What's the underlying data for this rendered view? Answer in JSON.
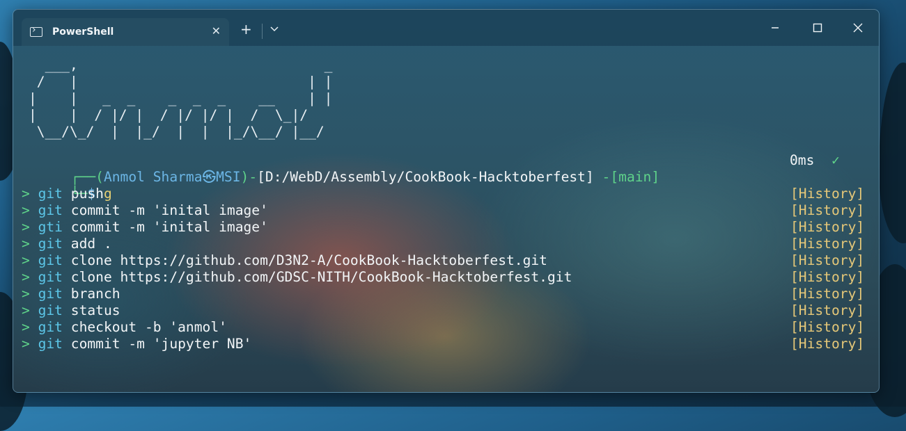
{
  "tab": {
    "title": "PowerShell",
    "close_glyph": "✕"
  },
  "controls": {
    "new_tab": "+",
    "dropdown": "chevron-down-icon",
    "minimize": "minimize-icon",
    "maximize": "maximize-icon",
    "close": "close-icon"
  },
  "ascii_art": "  ___,                              _\n /   |                            | |\n|    |   _  _    _  _  _    __    | |\n|    |  / |/ |  / |/ |/ |  /  \\_|/\n \\__/\\_/  |  |_/  |  |  |_/\\__/ |__/",
  "prompt": {
    "corner_top": "┌──",
    "user_open": "(",
    "user": "Anmol Sharma",
    "at_glyph": "㉿",
    "host": "MSI",
    "user_close": ")",
    "dash": "-",
    "path": "[D:/WebD/Assembly/CookBook-Hacktoberfest]",
    "git_prefix": " -[",
    "git_glyph": "",
    "branch": "main",
    "git_suffix": "]",
    "time": "0ms",
    "check": "✓",
    "corner_bottom": "└─",
    "dollar": "$",
    "typed_char": "g"
  },
  "history": {
    "marker": ">",
    "tag": "[History]",
    "items": [
      {
        "head": "git",
        "rest": " push"
      },
      {
        "head": "git",
        "rest": " commit -m 'inital image'"
      },
      {
        "head": "gti",
        "rest": " commit -m 'inital image'"
      },
      {
        "head": "git",
        "rest": " add ."
      },
      {
        "head": "git",
        "rest": " clone https://github.com/D3N2-A/CookBook-Hacktoberfest.git"
      },
      {
        "head": "git",
        "rest": " clone https://github.com/GDSC-NITH/CookBook-Hacktoberfest.git"
      },
      {
        "head": "git",
        "rest": " branch"
      },
      {
        "head": "git",
        "rest": " status"
      },
      {
        "head": "git",
        "rest": " checkout -b 'anmol'"
      },
      {
        "head": "git",
        "rest": " commit -m 'jupyter NB'"
      }
    ]
  },
  "colors": {
    "prompt_green": "#5fd38a",
    "user_blue": "#6cb6e6",
    "history_gold": "#e6c878",
    "cmd_cyan": "#5cc6e8"
  }
}
